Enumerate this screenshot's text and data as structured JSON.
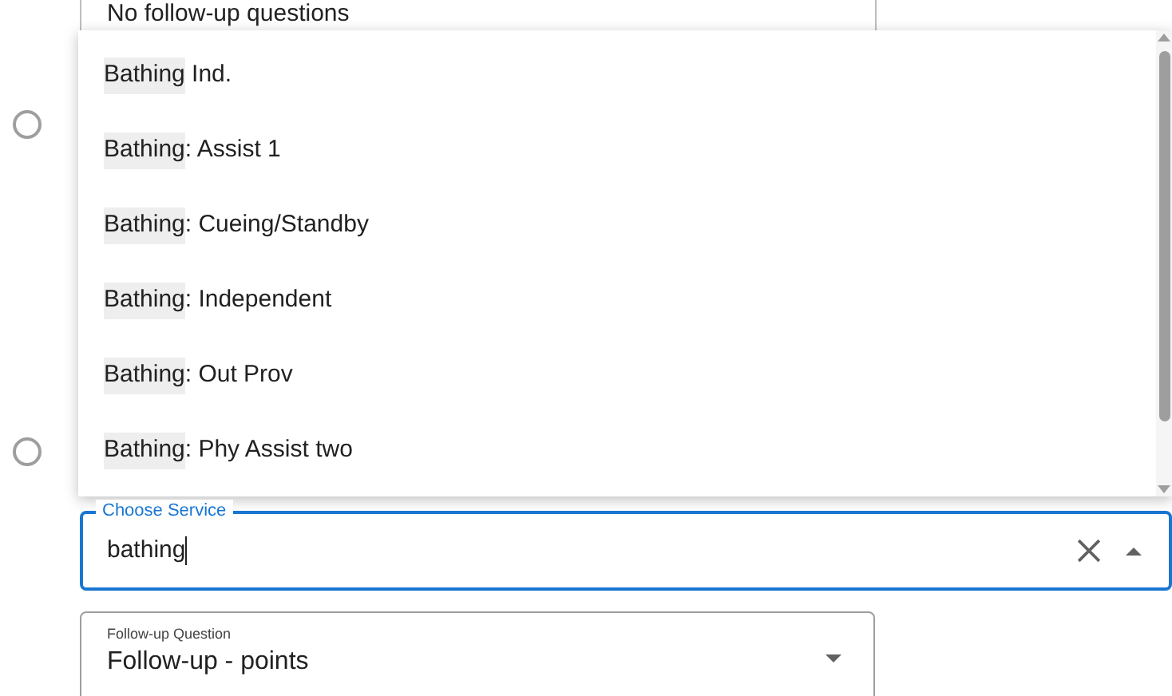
{
  "previous_field": {
    "value": "No follow-up questions"
  },
  "radios": [
    {
      "selected": false
    },
    {
      "selected": false
    }
  ],
  "options": [
    {
      "match": "Bathing",
      "rest": " Ind."
    },
    {
      "match": "Bathing",
      "rest": ": Assist 1"
    },
    {
      "match": "Bathing",
      "rest": ": Cueing/Standby"
    },
    {
      "match": "Bathing",
      "rest": ": Independent"
    },
    {
      "match": "Bathing",
      "rest": ": Out Prov"
    },
    {
      "match": "Bathing",
      "rest": ": Phy Assist two"
    }
  ],
  "service_field": {
    "label": "Choose Service",
    "value": "bathing",
    "focused": true
  },
  "followup_field": {
    "label": "Follow-up Question",
    "value": "Follow-up - points"
  }
}
